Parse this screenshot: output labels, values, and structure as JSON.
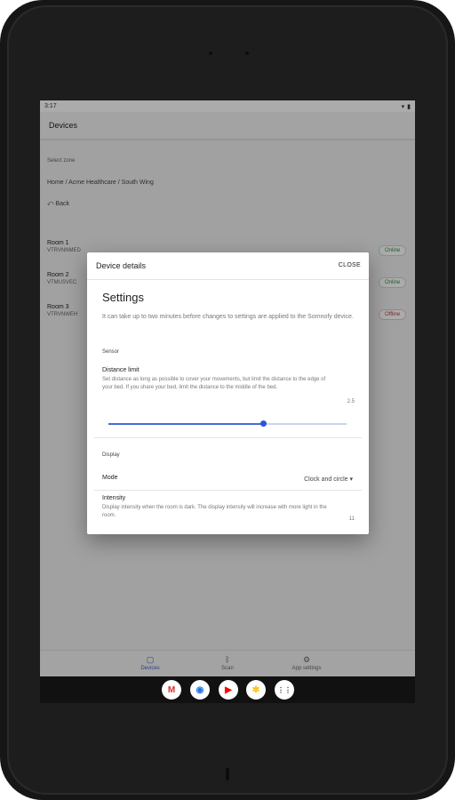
{
  "status_bar": {
    "time": "3:17",
    "notif_icon": "cast-icon",
    "right_icons": [
      "wifi-icon",
      "battery-icon"
    ]
  },
  "app": {
    "title": "Devices"
  },
  "zone": {
    "label": "Select zone",
    "path": "Home / Acme Healthcare / South Wing",
    "back": "⤺ Back"
  },
  "rooms": [
    {
      "name": "Room 1",
      "id": "VTRVNNMED",
      "status": "Online"
    },
    {
      "name": "Room 2",
      "id": "VTMUSVEC",
      "status": "Online"
    },
    {
      "name": "Room 3",
      "id": "VTRVNWEH",
      "status": "Offline"
    }
  ],
  "dialog": {
    "title": "Device details",
    "close_label": "CLOSE",
    "heading": "Settings",
    "note": "It can take up to two minutes before changes to settings are applied to the Somnofy device.",
    "sensor_section": "Sensor",
    "distance_title": "Distance limit",
    "distance_desc": "Set distance as long as possible to cover your movements, but limit the distance to the edge of your bed. If you share your bed, limit the distance to the middle of the bed.",
    "distance_value": "2.5",
    "distance_fraction": 0.65,
    "display_section": "Display",
    "mode_label": "Mode",
    "mode_value": "Clock and circle ▾",
    "intensity_title": "Intensity",
    "intensity_desc": "Display intensity when the room is dark. The display intensity will increase with more light in the room.",
    "intensity_value": "11"
  },
  "bottom_nav": [
    {
      "label": "Devices",
      "icon": "devices-icon",
      "glyph": "▢",
      "active": true
    },
    {
      "label": "Scan",
      "icon": "bluetooth-icon",
      "glyph": "ᛒ",
      "active": false
    },
    {
      "label": "App settings",
      "icon": "gear-icon",
      "glyph": "⚙",
      "active": false
    }
  ],
  "dock": [
    {
      "name": "gmail-icon",
      "glyph": "M",
      "color": "#d93025"
    },
    {
      "name": "chrome-icon",
      "glyph": "◉",
      "color": "#1a73e8"
    },
    {
      "name": "youtube-icon",
      "glyph": "▶",
      "color": "#ff0000"
    },
    {
      "name": "photos-icon",
      "glyph": "✻",
      "color": "#fbbc04"
    },
    {
      "name": "app-drawer-icon",
      "glyph": "⋮⋮",
      "color": "#333333"
    }
  ],
  "colors": {
    "accent": "#3f5fc7",
    "online": "#3c8a3c",
    "offline": "#c23b3b"
  }
}
